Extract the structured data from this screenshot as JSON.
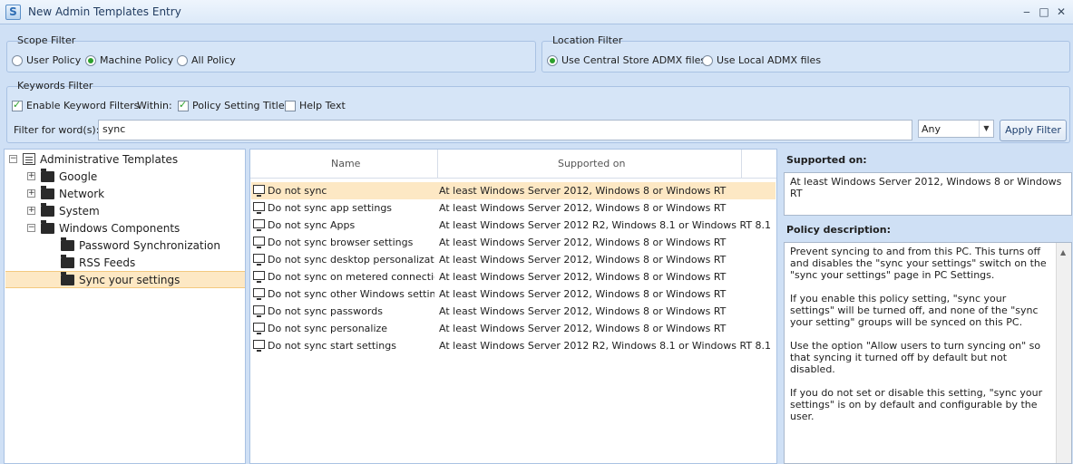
{
  "window": {
    "title": "New Admin Templates Entry",
    "minimize": "‒",
    "maximize": "□",
    "close": "✕"
  },
  "scope_filter": {
    "label": "Scope Filter",
    "options": [
      {
        "label": "User Policy",
        "selected": false
      },
      {
        "label": "Machine Policy",
        "selected": true
      },
      {
        "label": "All Policy",
        "selected": false
      }
    ]
  },
  "location_filter": {
    "label": "Location Filter",
    "options": [
      {
        "label": "Use Central Store ADMX files",
        "selected": true
      },
      {
        "label": "Use Local ADMX files",
        "selected": false
      }
    ]
  },
  "keywords_filter": {
    "label": "Keywords Filter",
    "enable_label": "Enable Keyword Filters",
    "enable_checked": true,
    "within_label": "Within:",
    "policy_title_label": "Policy Setting Title",
    "policy_title_checked": true,
    "help_text_label": "Help Text",
    "help_text_checked": false,
    "filter_label": "Filter for word(s):",
    "filter_value": "sync",
    "match_value": "Any",
    "apply_label": "Apply Filter"
  },
  "tree": {
    "root": "Administrative Templates",
    "items": [
      {
        "label": "Google",
        "expander": "+"
      },
      {
        "label": "Network",
        "expander": "+"
      },
      {
        "label": "System",
        "expander": "+"
      },
      {
        "label": "Windows Components",
        "expander": "−"
      }
    ],
    "children": [
      {
        "label": "Password Synchronization"
      },
      {
        "label": "RSS Feeds"
      },
      {
        "label": "Sync your settings"
      }
    ],
    "selected": "Sync your settings"
  },
  "policy_list": {
    "columns": [
      "Name",
      "Supported on"
    ],
    "rows": [
      {
        "name": "Do not sync",
        "supported": "At least Windows Server 2012, Windows 8 or Windows RT"
      },
      {
        "name": "Do not sync app settings",
        "supported": "At least Windows Server 2012, Windows 8 or Windows RT"
      },
      {
        "name": "Do not sync Apps",
        "supported": "At least Windows Server 2012 R2, Windows 8.1 or Windows RT 8.1"
      },
      {
        "name": "Do not sync browser settings",
        "supported": "At least Windows Server 2012, Windows 8 or Windows RT"
      },
      {
        "name": "Do not sync desktop personalization",
        "supported": "At least Windows Server 2012, Windows 8 or Windows RT"
      },
      {
        "name": "Do not sync on metered connections",
        "supported": "At least Windows Server 2012, Windows 8 or Windows RT"
      },
      {
        "name": "Do not sync other Windows settings",
        "supported": "At least Windows Server 2012, Windows 8 or Windows RT"
      },
      {
        "name": "Do not sync passwords",
        "supported": "At least Windows Server 2012, Windows 8 or Windows RT"
      },
      {
        "name": "Do not sync personalize",
        "supported": "At least Windows Server 2012, Windows 8 or Windows RT"
      },
      {
        "name": "Do not sync start settings",
        "supported": "At least Windows Server 2012 R2, Windows 8.1 or Windows RT 8.1"
      }
    ]
  },
  "details": {
    "supported_label": "Supported on:",
    "supported_value": "At least Windows Server 2012, Windows 8 or Windows RT",
    "description_label": "Policy description:",
    "description": [
      "Prevent syncing to and from this PC.  This turns off and disables the \"sync your settings\" switch on the \"sync your settings\" page in PC Settings.",
      "If you enable this policy setting, \"sync your settings\" will be turned off, and none of the \"sync your setting\" groups will be synced on this PC.",
      "Use the option \"Allow users to turn syncing on\" so that syncing it turned off by default but not disabled.",
      "If you do not set or disable this setting, \"sync your settings\" is on by default and configurable by the user."
    ]
  },
  "colors": {
    "background": "#cfe0f5",
    "selection": "#fde8c4",
    "radio_check": "#2ca02c"
  }
}
